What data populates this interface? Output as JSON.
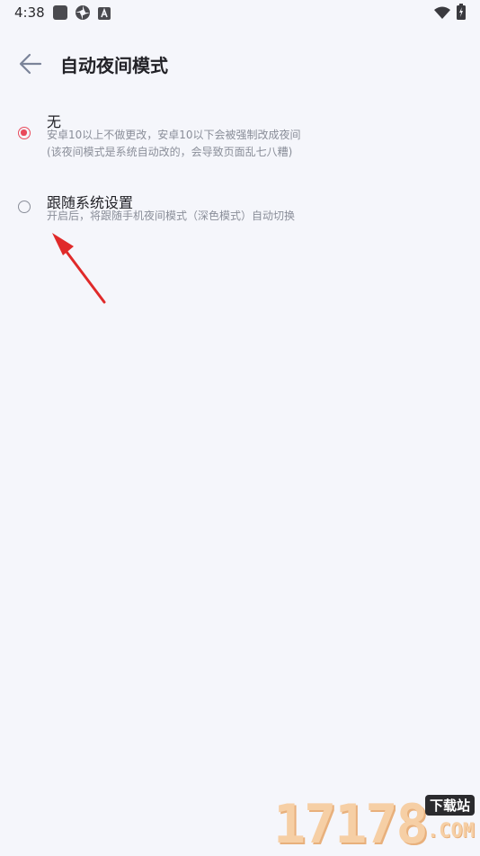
{
  "status_bar": {
    "time": "4:38",
    "icons": [
      "app-square-icon",
      "app-flower-icon",
      "app-a-icon",
      "wifi-icon",
      "battery-charging-icon"
    ]
  },
  "header": {
    "title": "自动夜间模式",
    "back_icon": "back-arrow-icon"
  },
  "options": [
    {
      "title": "无",
      "description": [
        "安卓10以上不做更改，安卓10以下会被强制改成夜间",
        "(该夜间模式是系统自动改的，会导致页面乱七八糟)"
      ],
      "selected": true
    },
    {
      "title": "跟随系统设置",
      "description": [
        "开启后，将跟随手机夜间模式（深色模式）自动切换"
      ],
      "selected": false
    }
  ],
  "annotation": {
    "type": "red-arrow",
    "color": "#e02a2a"
  },
  "watermark": {
    "number": "17178",
    "badge": "下载站",
    "suffix": ".COM"
  },
  "colors": {
    "accent": "#e94a5c",
    "background": "#f5f6fb",
    "secondary_text": "#8a8e99"
  }
}
